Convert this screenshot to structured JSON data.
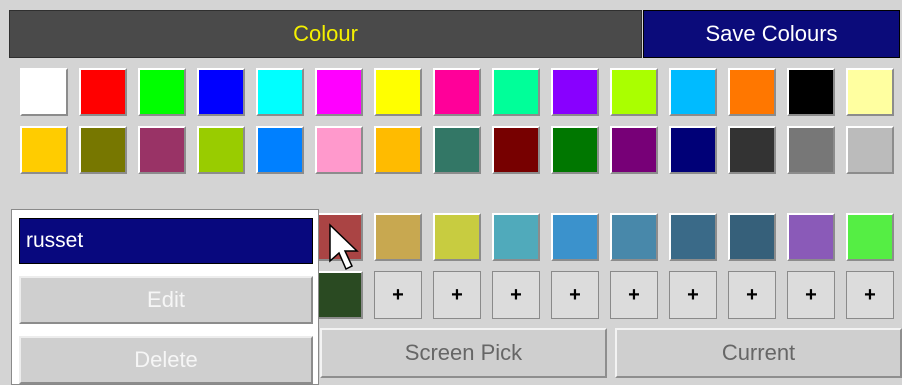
{
  "header": {
    "title": "Colour",
    "save_label": "Save Colours"
  },
  "palette": {
    "row1": [
      "#ffffff",
      "#ff0000",
      "#00ff00",
      "#0000ff",
      "#00ffff",
      "#ff00ff",
      "#ffff00",
      "#ff0099",
      "#00ff99",
      "#8800ff",
      "#aaff00",
      "#00bbff",
      "#ff7700",
      "#000000",
      "#ffffa0"
    ],
    "row2": [
      "#ffcc00",
      "#777700",
      "#993366",
      "#99cc00",
      "#0080ff",
      "#ff99cc",
      "#ffbb00",
      "#337766",
      "#770000",
      "#007700",
      "#770077",
      "#000077",
      "#333333",
      "#777777",
      "#bbbbbb"
    ],
    "row3": [
      "#aa4444",
      "#c8a850",
      "#c8cc40",
      "#50aabb",
      "#3b92cc",
      "#4888aa",
      "#3a6a88",
      "#36607a",
      "#8a5ab8",
      "#55ee44"
    ],
    "row4_swatch": "#2a4a22",
    "plus_label": "+",
    "plus_count": 10
  },
  "buttons": {
    "screen_pick": "Screen Pick",
    "current": "Current"
  },
  "popup": {
    "name_value": "russet",
    "edit_label": "Edit",
    "delete_label": "Delete"
  }
}
